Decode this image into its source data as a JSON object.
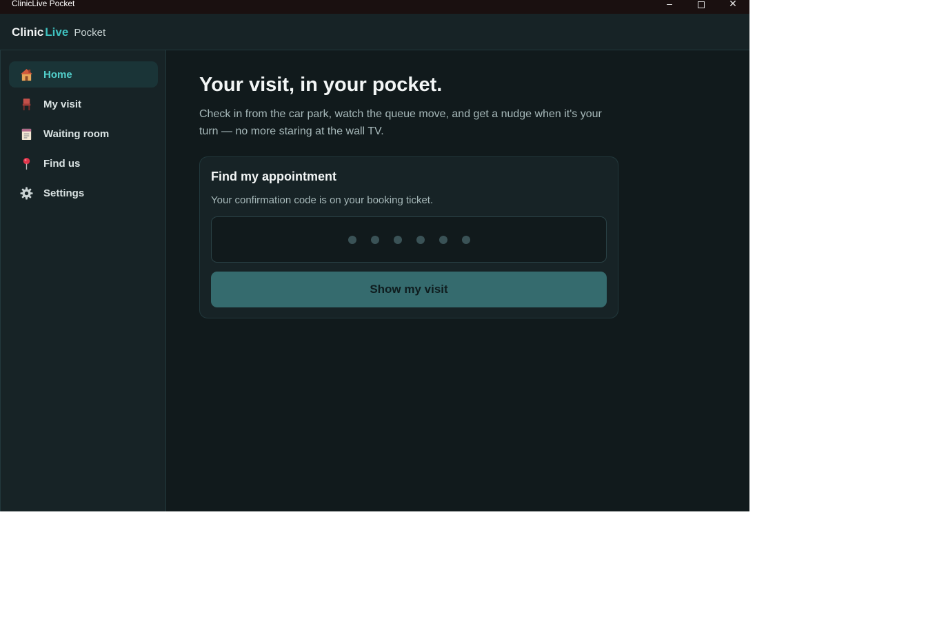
{
  "window": {
    "title": "ClinicLive Pocket",
    "min_glyph": "–",
    "close_glyph": "✕"
  },
  "brand": {
    "part1": "Clinic",
    "part2": "Live",
    "part3": "Pocket",
    "accent_color": "#3fc1bf"
  },
  "sidebar": {
    "items": [
      {
        "label": "Home",
        "icon": "house-icon",
        "active": true
      },
      {
        "label": "My visit",
        "icon": "chair-icon",
        "active": false
      },
      {
        "label": "Waiting room",
        "icon": "clipboard-icon",
        "active": false
      },
      {
        "label": "Find us",
        "icon": "pin-icon",
        "active": false
      },
      {
        "label": "Settings",
        "icon": "gear-icon",
        "active": false
      }
    ]
  },
  "main": {
    "heading": "Your visit, in your pocket.",
    "lead": "Check in from the car park, watch the queue move, and get a nudge when it's your turn — no more staring at the wall TV.",
    "card": {
      "title": "Find my appointment",
      "subtitle": "Your confirmation code is on your booking ticket.",
      "code_value": "",
      "code_length": 6,
      "button_label": "Show my visit"
    }
  }
}
